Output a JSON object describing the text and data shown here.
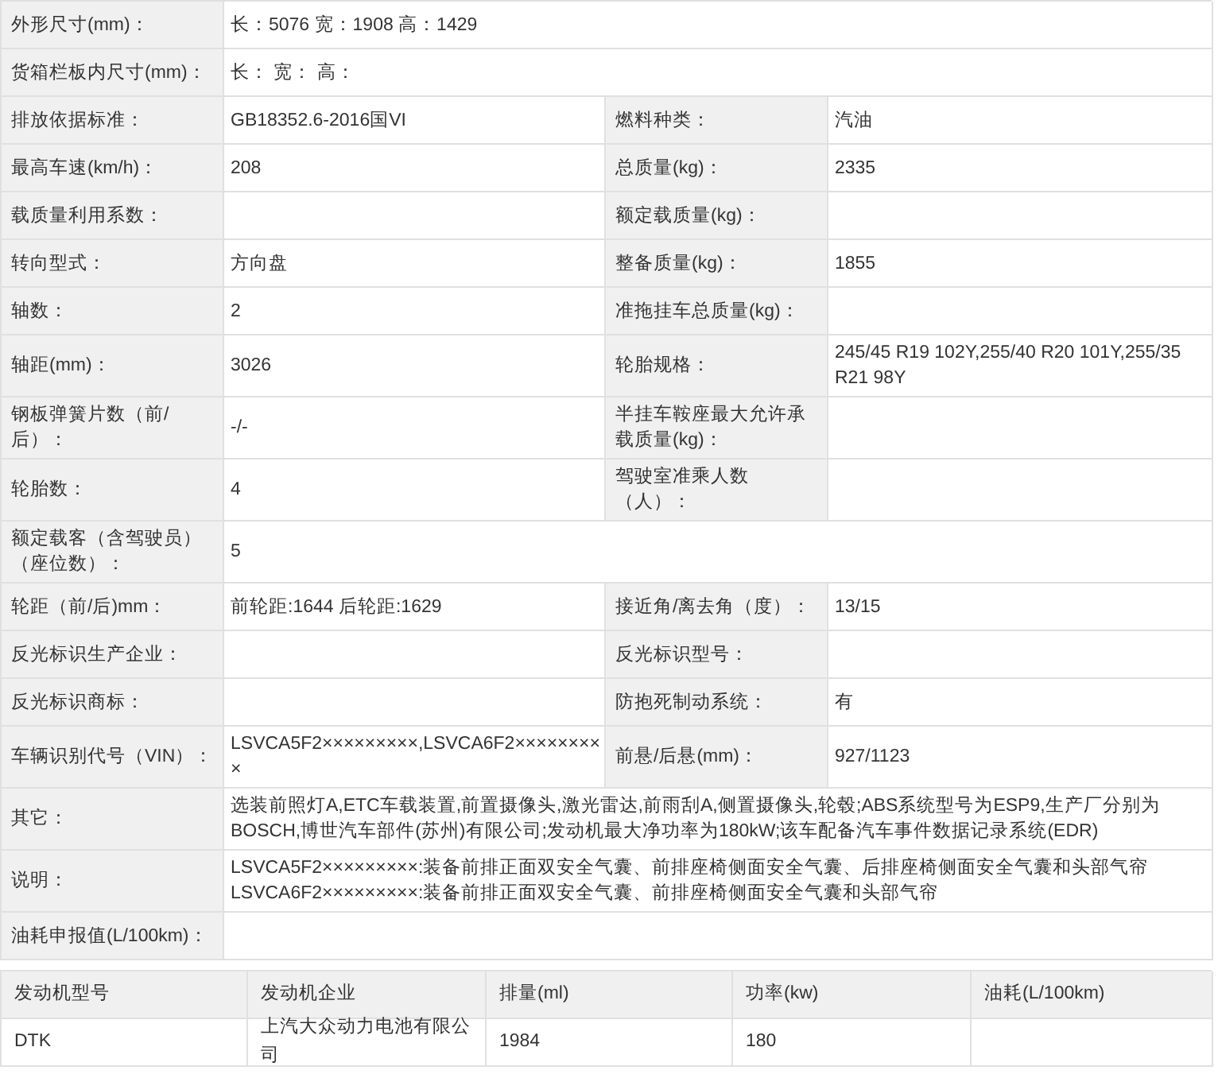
{
  "spec_rows": [
    {
      "kind": "full",
      "label": "外形尺寸(mm)：",
      "value": "长：5076 宽：1908 高：1429"
    },
    {
      "kind": "full",
      "label": "货箱栏板内尺寸(mm)：",
      "value": "长： 宽： 高："
    },
    {
      "kind": "pair",
      "label": "排放依据标准：",
      "value": "GB18352.6-2016国VI",
      "label2": "燃料种类：",
      "value2": "汽油"
    },
    {
      "kind": "pair",
      "label": "最高车速(km/h)：",
      "value": "208",
      "label2": "总质量(kg)：",
      "value2": "2335"
    },
    {
      "kind": "pair",
      "label": "载质量利用系数：",
      "label2": "额定载质量(kg)："
    },
    {
      "kind": "pair",
      "label": "转向型式：",
      "value": "方向盘",
      "label2": "整备质量(kg)：",
      "value2": "1855"
    },
    {
      "kind": "pair",
      "label": "轴数：",
      "value": "2",
      "label2": "准拖挂车总质量(kg)："
    },
    {
      "kind": "pair",
      "label": "轴距(mm)：",
      "value": "3026",
      "label2": "轮胎规格：",
      "value2": "245/45 R19 102Y,255/40 R20 101Y,255/35 R21 98Y"
    },
    {
      "kind": "pair",
      "label": "钢板弹簧片数（前/后）：",
      "value": "-/-",
      "label2": "半挂车鞍座最大允许承载质量(kg)："
    },
    {
      "kind": "pair",
      "label": "轮胎数：",
      "value": "4",
      "label2": "驾驶室准乘人数（人）："
    },
    {
      "kind": "full",
      "label": "额定载客（含驾驶员）（座位数）：",
      "value": "5"
    },
    {
      "kind": "pair",
      "label": "轮距（前/后)mm：",
      "value": "前轮距:1644 后轮距:1629",
      "label2": "接近角/离去角（度）：",
      "value2": "13/15"
    },
    {
      "kind": "pair",
      "label": "反光标识生产企业：",
      "label2": "反光标识型号："
    },
    {
      "kind": "pair",
      "label": "反光标识商标：",
      "label2": "防抱死制动系统：",
      "value2": "有"
    },
    {
      "kind": "pair",
      "label": "车辆识别代号（VIN）：",
      "value": "LSVCA5F2×××××××××,LSVCA6F2×××××××××",
      "label2": "前悬/后悬(mm)：",
      "value2": "927/1123"
    },
    {
      "kind": "full",
      "label": "其它：",
      "value": "选装前照灯A,ETC车载装置,前置摄像头,激光雷达,前雨刮A,侧置摄像头,轮毂;ABS系统型号为ESP9,生产厂分别为BOSCH,博世汽车部件(苏州)有限公司;发动机最大净功率为180kW;该车配备汽车事件数据记录系统(EDR)"
    },
    {
      "kind": "full",
      "label": "说明：",
      "value": "LSVCA5F2×××××××××:装备前排正面双安全气囊、前排座椅侧面安全气囊、后排座椅侧面安全气囊和头部气帘 LSVCA6F2×××××××××:装备前排正面双安全气囊、前排座椅侧面安全气囊和头部气帘"
    },
    {
      "kind": "full",
      "label": "油耗申报值(L/100km)："
    }
  ],
  "engine_table": {
    "columns": [
      "发动机型号",
      "发动机企业",
      "排量(ml)",
      "功率(kw)",
      "油耗(L/100km)"
    ],
    "rows": [
      [
        "DTK",
        "上汽大众动力电池有限公司",
        "1984",
        "180"
      ]
    ]
  }
}
